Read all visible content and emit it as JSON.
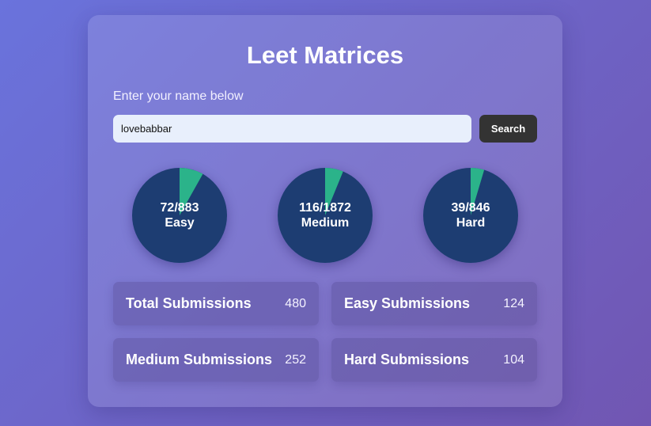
{
  "header": {
    "title": "Leet Matrices"
  },
  "search": {
    "prompt": "Enter your name below",
    "value": "lovebabbar",
    "button_label": "Search"
  },
  "colors": {
    "solved": "#2bb38a",
    "unsolved": "#1d3d72"
  },
  "progress": [
    {
      "solved": 72,
      "total": 883,
      "label": "72/883",
      "difficulty": "Easy"
    },
    {
      "solved": 116,
      "total": 1872,
      "label": "116/1872",
      "difficulty": "Medium"
    },
    {
      "solved": 39,
      "total": 846,
      "label": "39/846",
      "difficulty": "Hard"
    }
  ],
  "stats": [
    {
      "label": "Total Submissions",
      "value": "480"
    },
    {
      "label": "Easy Submissions",
      "value": "124"
    },
    {
      "label": "Medium Submissions",
      "value": "252"
    },
    {
      "label": "Hard Submissions",
      "value": "104"
    }
  ]
}
